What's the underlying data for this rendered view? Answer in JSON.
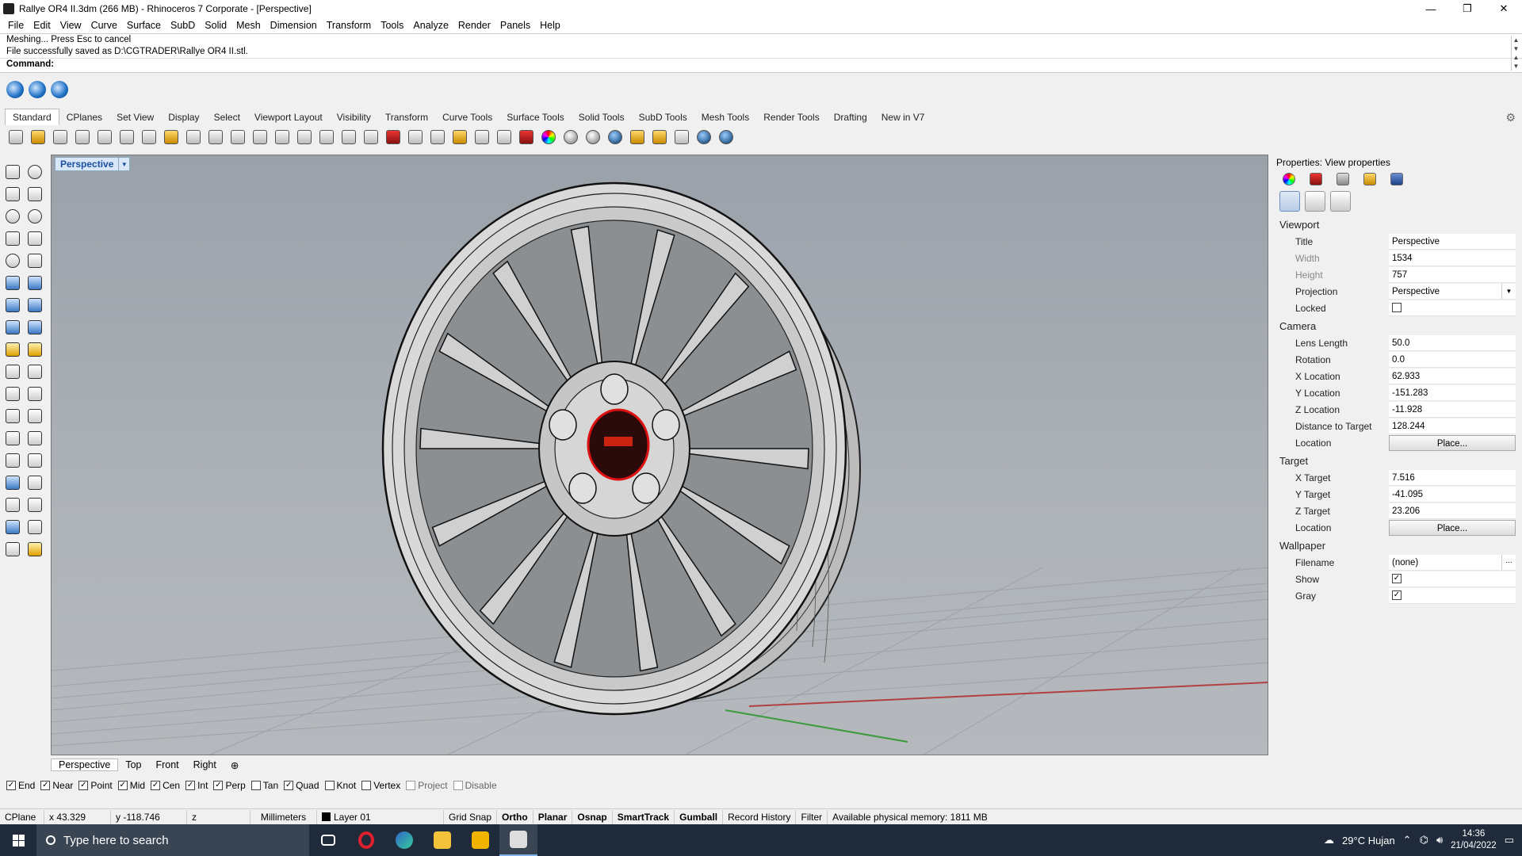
{
  "window": {
    "title": "Rallye OR4 II.3dm (266 MB) - Rhinoceros 7 Corporate - [Perspective]",
    "controls": [
      "—",
      "❐",
      "✕"
    ]
  },
  "menu": [
    "File",
    "Edit",
    "View",
    "Curve",
    "Surface",
    "SubD",
    "Solid",
    "Mesh",
    "Dimension",
    "Transform",
    "Tools",
    "Analyze",
    "Render",
    "Panels",
    "Help"
  ],
  "command": {
    "history": [
      "Meshing... Press Esc to cancel",
      "File successfully saved as D:\\CGTRADER\\Rallye OR4 II.stl."
    ],
    "prompt": "Command:",
    "value": ""
  },
  "toolbar_tabs": [
    "Standard",
    "CPlanes",
    "Set View",
    "Display",
    "Select",
    "Viewport Layout",
    "Visibility",
    "Transform",
    "Curve Tools",
    "Surface Tools",
    "Solid Tools",
    "SubD Tools",
    "Mesh Tools",
    "Render Tools",
    "Drafting",
    "New in V7"
  ],
  "viewport": {
    "label": "Perspective",
    "axis_x": "x",
    "axis_y": "y",
    "axis_z": "z"
  },
  "viewport_tabs": [
    "Perspective",
    "Top",
    "Front",
    "Right",
    "⊕"
  ],
  "osnaps": [
    {
      "label": "End",
      "checked": true
    },
    {
      "label": "Near",
      "checked": true
    },
    {
      "label": "Point",
      "checked": true
    },
    {
      "label": "Mid",
      "checked": true
    },
    {
      "label": "Cen",
      "checked": true
    },
    {
      "label": "Int",
      "checked": true
    },
    {
      "label": "Perp",
      "checked": true
    },
    {
      "label": "Tan",
      "checked": false
    },
    {
      "label": "Quad",
      "checked": true
    },
    {
      "label": "Knot",
      "checked": false
    },
    {
      "label": "Vertex",
      "checked": false
    },
    {
      "label": "Project",
      "checked": false
    },
    {
      "label": "Disable",
      "checked": false
    }
  ],
  "statusbar": {
    "cplane": "CPlane",
    "x": "x 43.329",
    "y": "y -118.746",
    "z": "z",
    "units": "Millimeters",
    "layer": "Layer 01",
    "grid_snap": "Grid Snap",
    "ortho": "Ortho",
    "planar": "Planar",
    "osnap": "Osnap",
    "smarttrack": "SmartTrack",
    "gumball": "Gumball",
    "record_history": "Record History",
    "filter": "Filter",
    "memory": "Available physical memory: 1811 MB"
  },
  "properties": {
    "title": "Properties: View properties",
    "sections": {
      "viewport": "Viewport",
      "camera": "Camera",
      "target": "Target",
      "wallpaper": "Wallpaper"
    },
    "viewport_rows": {
      "title_label": "Title",
      "title_value": "Perspective",
      "width_label": "Width",
      "width_value": "1534",
      "height_label": "Height",
      "height_value": "757",
      "projection_label": "Projection",
      "projection_value": "Perspective",
      "locked_label": "Locked",
      "locked_checked": false
    },
    "camera_rows": {
      "lens_label": "Lens Length",
      "lens_value": "50.0",
      "rotation_label": "Rotation",
      "rotation_value": "0.0",
      "xloc_label": "X Location",
      "xloc_value": "62.933",
      "yloc_label": "Y Location",
      "yloc_value": "-151.283",
      "zloc_label": "Z Location",
      "zloc_value": "-11.928",
      "dist_label": "Distance to Target",
      "dist_value": "128.244",
      "location_label": "Location",
      "place_button": "Place..."
    },
    "target_rows": {
      "xt_label": "X Target",
      "xt_value": "7.516",
      "yt_label": "Y Target",
      "yt_value": "-41.095",
      "zt_label": "Z Target",
      "zt_value": "23.206",
      "location_label": "Location",
      "place_button": "Place..."
    },
    "wallpaper_rows": {
      "filename_label": "Filename",
      "filename_value": "(none)",
      "browse": "...",
      "show_label": "Show",
      "show_checked": true,
      "gray_label": "Gray",
      "gray_checked": true
    }
  },
  "taskbar": {
    "search_placeholder": "Type here to search",
    "weather": "29°C  Hujan",
    "time": "14:36",
    "date": "21/04/2022"
  }
}
